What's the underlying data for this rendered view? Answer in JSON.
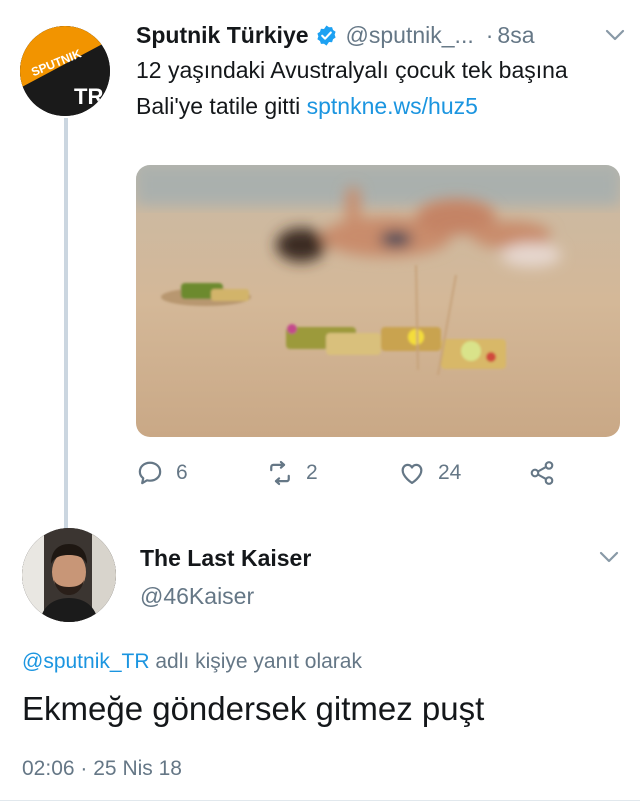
{
  "tweet": {
    "author_name": "Sputnik Türkiye",
    "handle": "@sputnik_...",
    "separator": "·",
    "time": "8sa",
    "text": "12 yaşındaki Avustralyalı çocuk tek başına Bali'ye tatile gitti",
    "link": "sptnkne.ws/huz5",
    "avatar": {
      "logo_text": "SPUTNIK",
      "badge": "TR",
      "brand_color": "#f29400"
    },
    "actions": {
      "reply_count": "6",
      "retweet_count": "2",
      "like_count": "24",
      "icons": [
        "reply-icon",
        "retweet-icon",
        "like-icon",
        "share-icon"
      ]
    }
  },
  "reply": {
    "author_name": "The Last Kaiser",
    "handle": "@46Kaiser",
    "context_mention": "@sputnik_TR",
    "context_text": "adlı kişiye yanıt olarak",
    "text": "Ekmeğe göndersek gitmez puşt",
    "time": "02:06",
    "separator": "·",
    "date": "25 Nis 18"
  },
  "colors": {
    "link": "#1b95e0",
    "secondary_text": "#657786",
    "thread_line": "#cbd6e0",
    "verified": "#1da1f2"
  }
}
